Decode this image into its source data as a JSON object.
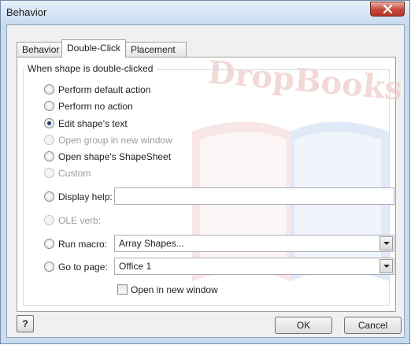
{
  "window": {
    "title": "Behavior"
  },
  "tabs": [
    {
      "label": "Behavior"
    },
    {
      "label": "Double-Click"
    },
    {
      "label": "Placement"
    }
  ],
  "group": {
    "label": "When shape is double-clicked"
  },
  "options": {
    "default_action": "Perform default action",
    "no_action": "Perform no action",
    "edit_text": "Edit shape's text",
    "open_group": "Open group in new window",
    "open_shapesheet": "Open shape's ShapeSheet",
    "custom": "Custom",
    "display_help": "Display help:",
    "ole_verb": "OLE verb:",
    "run_macro": "Run macro:",
    "go_to_page": "Go to page:"
  },
  "fields": {
    "display_help_value": "",
    "run_macro_value": "Array Shapes...",
    "go_to_page_value": "Office 1"
  },
  "checkbox": {
    "open_new_window": "Open in new window"
  },
  "buttons": {
    "ok": "OK",
    "cancel": "Cancel",
    "help": "?"
  },
  "watermark": {
    "text": "DropBooks"
  }
}
